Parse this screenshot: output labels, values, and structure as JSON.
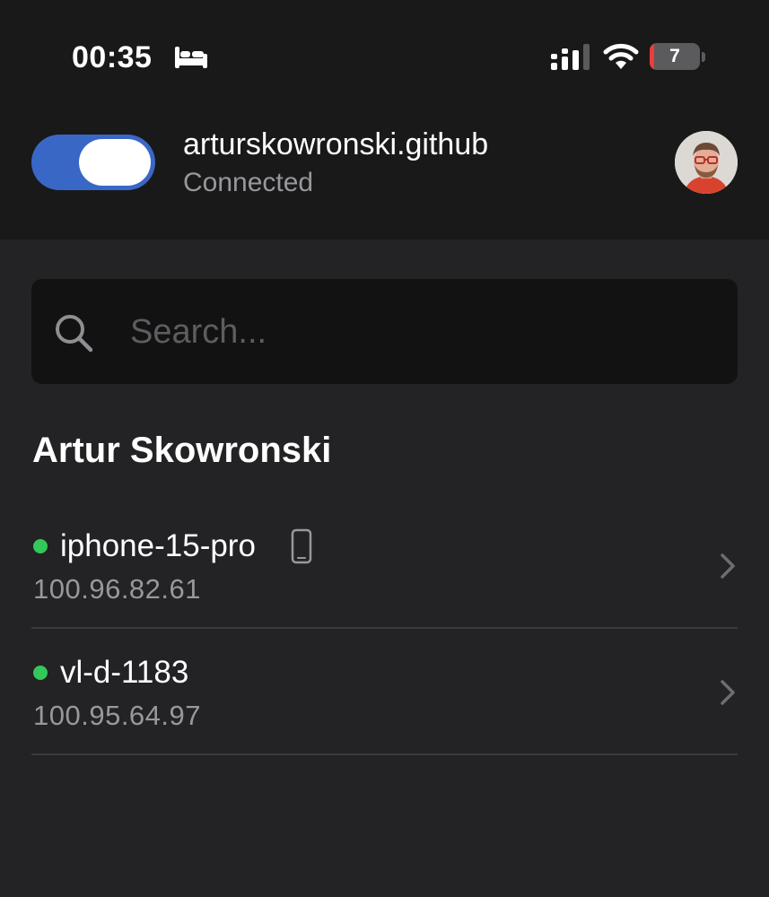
{
  "status_bar": {
    "time": "00:35",
    "focus_icon": "bed-icon",
    "signal_icon": "cellular-signal-icon",
    "wifi_icon": "wifi-icon",
    "battery_level": "7",
    "battery_color": "#eb3c3f"
  },
  "connection": {
    "toggle_on": true,
    "toggle_color": "#3967c6",
    "account": "arturskowronski.github",
    "status": "Connected",
    "avatar_icon": "user-avatar"
  },
  "search": {
    "placeholder": "Search...",
    "value": ""
  },
  "section": {
    "title": "Artur Skowronski"
  },
  "devices": [
    {
      "name": "iphone-15-pro",
      "ip": "100.96.82.61",
      "online": true,
      "type_icon": "phone-icon"
    },
    {
      "name": "vl-d-1183",
      "ip": "100.95.64.97",
      "online": true,
      "type_icon": ""
    }
  ],
  "colors": {
    "online_dot": "#34c759",
    "header_bg": "#19191a",
    "body_bg": "#232224"
  }
}
